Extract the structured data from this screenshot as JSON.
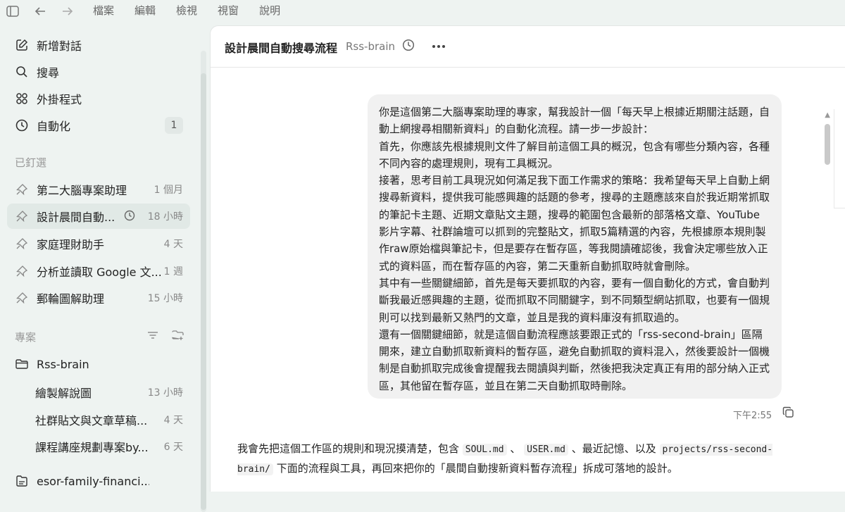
{
  "menu": [
    "檔案",
    "編輯",
    "檢視",
    "視窗",
    "說明"
  ],
  "sidebar": {
    "actions": [
      {
        "label": "新增對話",
        "icon": "edit-icon"
      },
      {
        "label": "搜尋",
        "icon": "search-icon"
      },
      {
        "label": "外掛程式",
        "icon": "plugins-icon"
      },
      {
        "label": "自動化",
        "icon": "clock-icon",
        "badge": "1"
      }
    ],
    "pinned_header": "已釘選",
    "pinned": [
      {
        "label": "第二大腦專案助理",
        "meta": "1 個月"
      },
      {
        "label": "設計晨間自動...",
        "meta": "18 小時",
        "active": true
      },
      {
        "label": "家庭理財助手",
        "meta": "4 天"
      },
      {
        "label": "分析並讀取 Google 文...",
        "meta": "1 週"
      },
      {
        "label": "郵輪圖解助理",
        "meta": "15 小時"
      }
    ],
    "projects_header": "專案",
    "project_name": "Rss-brain",
    "project_items": [
      {
        "label": "繪製解說圖",
        "meta": "13 小時"
      },
      {
        "label": "社群貼文與文章草稿...",
        "meta": "4 天"
      },
      {
        "label": "課程講座規劃專案by...",
        "meta": "6 天"
      }
    ],
    "last_item": "esor-family-financi..."
  },
  "header": {
    "title": "設計晨間自動搜尋流程",
    "project": "Rss-brain"
  },
  "message": {
    "paragraphs": [
      "你是這個第二大腦專案助理的專家，幫我設計一個「每天早上根據近期關注話題，自動上網搜尋相關新資料」的自動化流程。請一步一步設計：",
      "首先，你應該先根據規則文件了解目前這個工具的概況，包含有哪些分類內容，各種不同內容的處理規則，現有工具概況。",
      "接著，思考目前工具現況如何滿足我下面工作需求的策略：我希望每天早上自動上網搜尋新資料，提供我可能感興趣的話題的參考，搜尋的主題應該來自於我近期常抓取的筆記卡主題、近期文章貼文主題，搜尋的範圍包含最新的部落格文章、YouTube 影片字幕、社群論壇可以抓到的完整貼文，抓取5篇精選的內容，先根據原本規則製作raw原始檔與筆記卡，但是要存在暫存區，等我閱讀確認後，我會決定哪些放入正式的資料區，而在暫存區的內容，第二天重新自動抓取時就會刪除。",
      "其中有一些關鍵細節，首先是每天要抓取的內容，要有一個自動化的方式，會自動判斷我最近感興趣的主題，從而抓取不同關鍵字，到不同類型網站抓取，也要有一個規則可以找到最新又熱門的文章，並且是我的資料庫沒有抓取過的。",
      "還有一個關鍵細節，就是這個自動流程應該要跟正式的「rss-second-brain」區隔開來，建立自動抓取新資料的暫存區，避免自動抓取的資料混入，然後要設計一個機制是自動抓取完成後會提醒我去閱讀與判斷，然後把我決定真正有用的部分納入正式區，其他留在暫存區，並且在第二天自動抓取時刪除。"
    ],
    "time": "下午2:55"
  },
  "reply": {
    "t1": "我會先把這個工作區的規則和現況摸清楚，包含",
    "c1": "SOUL.md",
    "t2": "、",
    "c2": "USER.md",
    "t3": "、最近記憶、以及",
    "c3": "projects/rss-second-brain/",
    "t4": "下面的流程與工具，再回來把你的「晨間自動搜新資料暫存流程」拆成可落地的設計。"
  }
}
